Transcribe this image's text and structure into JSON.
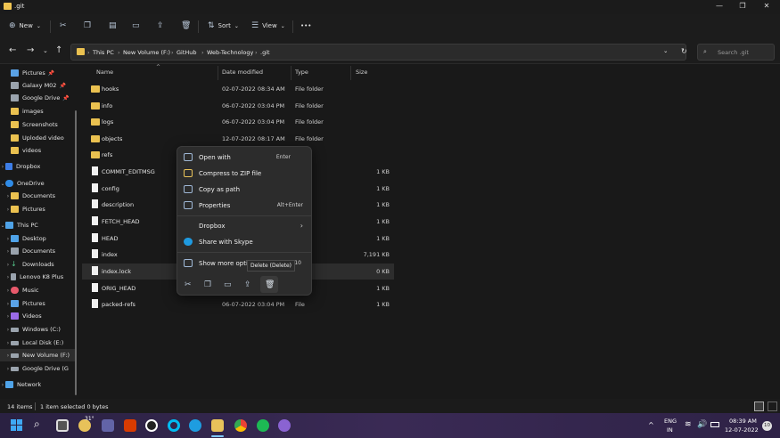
{
  "window": {
    "title": ".git",
    "minimize": "—",
    "maximize": "❐",
    "close": "✕"
  },
  "toolbar": {
    "new_label": "New",
    "sort_label": "Sort",
    "view_label": "View",
    "more_label": "•••"
  },
  "address": {
    "breadcrumbs": [
      "This PC",
      "New Volume (F:)",
      "GitHub",
      "Web-Technology",
      ".git"
    ],
    "search_placeholder": "Search .git"
  },
  "sidebar": {
    "items": [
      {
        "label": "Pictures",
        "pinned": true
      },
      {
        "label": "Galaxy M02",
        "pinned": true
      },
      {
        "label": "Google Drive",
        "pinned": true
      },
      {
        "label": "images"
      },
      {
        "label": "Screenshots"
      },
      {
        "label": "Uploded video"
      },
      {
        "label": "videos"
      },
      {
        "label": "Dropbox"
      },
      {
        "label": "OneDrive"
      },
      {
        "label": "Documents"
      },
      {
        "label": "Pictures"
      },
      {
        "label": "This PC"
      },
      {
        "label": "Desktop"
      },
      {
        "label": "Documents"
      },
      {
        "label": "Downloads"
      },
      {
        "label": "Lenovo K8 Plus"
      },
      {
        "label": "Music"
      },
      {
        "label": "Pictures"
      },
      {
        "label": "Videos"
      },
      {
        "label": "Windows (C:)"
      },
      {
        "label": "Local Disk (E:)"
      },
      {
        "label": "New Volume (F:)"
      },
      {
        "label": "Google Drive (G"
      },
      {
        "label": "Network"
      }
    ]
  },
  "columns": {
    "name": "Name",
    "date": "Date modified",
    "type": "Type",
    "size": "Size"
  },
  "files": [
    {
      "name": "hooks",
      "date": "02-07-2022 08:34 AM",
      "type": "File folder",
      "size": ""
    },
    {
      "name": "info",
      "date": "06-07-2022 03:04 PM",
      "type": "File folder",
      "size": ""
    },
    {
      "name": "logs",
      "date": "06-07-2022 03:04 PM",
      "type": "File folder",
      "size": ""
    },
    {
      "name": "objects",
      "date": "12-07-2022 08:17 AM",
      "type": "File folder",
      "size": ""
    },
    {
      "name": "refs",
      "date": "",
      "type": "folder",
      "size": ""
    },
    {
      "name": "COMMIT_EDITMSG",
      "date": "",
      "type": "",
      "size": "1 KB"
    },
    {
      "name": "config",
      "date": "",
      "type": "",
      "size": "1 KB"
    },
    {
      "name": "description",
      "date": "",
      "type": "",
      "size": "1 KB"
    },
    {
      "name": "FETCH_HEAD",
      "date": "",
      "type": "",
      "size": "1 KB"
    },
    {
      "name": "HEAD",
      "date": "",
      "type": "",
      "size": "1 KB"
    },
    {
      "name": "index",
      "date": "",
      "type": "",
      "size": "7,191 KB"
    },
    {
      "name": "index.lock",
      "date": "",
      "type": "File",
      "size": "0 KB"
    },
    {
      "name": "ORIG_HEAD",
      "date": "",
      "type": "",
      "size": "1 KB"
    },
    {
      "name": "packed-refs",
      "date": "06-07-2022 03:04 PM",
      "type": "File",
      "size": "1 KB"
    }
  ],
  "context_menu": {
    "open_with": "Open with",
    "open_with_shortcut": "Enter",
    "compress": "Compress to ZIP file",
    "copy_path": "Copy as path",
    "properties": "Properties",
    "properties_shortcut": "Alt+Enter",
    "dropbox": "Dropbox",
    "share_skype": "Share with Skype",
    "show_more": "Show more opti",
    "show_more_shortcut": "10"
  },
  "tooltip": "Delete (Delete)",
  "status": {
    "item_count": "14 items",
    "selection": "1 item selected  0 bytes"
  },
  "taskbar": {
    "weather": "31°",
    "lang": "ENG",
    "region": "IN",
    "time": "08:39 AM",
    "date": "12-07-2022",
    "notif_count": "10"
  }
}
